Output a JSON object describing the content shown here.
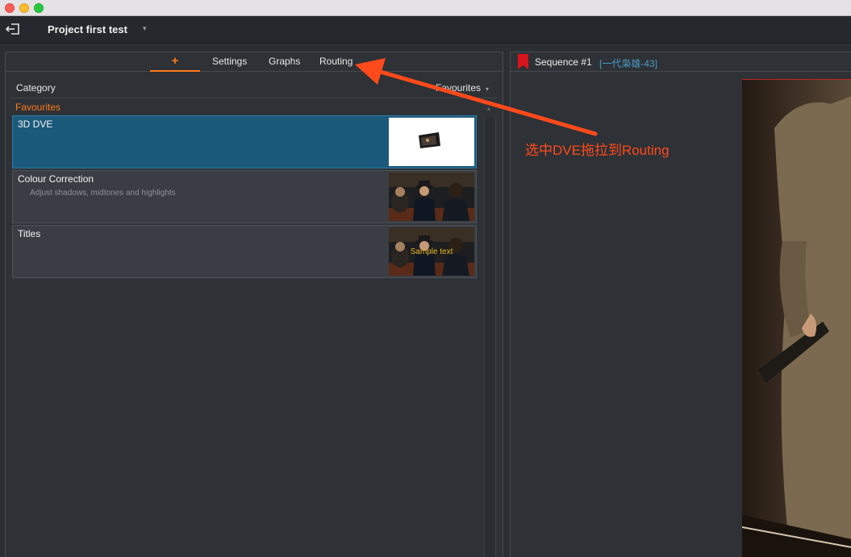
{
  "window": {
    "title": ""
  },
  "toolbar": {
    "project_title": "Project first test",
    "project_caret": "▾"
  },
  "left_panel": {
    "tabs": [
      {
        "label": "+",
        "active": true
      },
      {
        "label": "Settings",
        "active": false
      },
      {
        "label": "Graphs",
        "active": false
      },
      {
        "label": "Routing",
        "active": false
      }
    ],
    "category_label": "Category",
    "category_selected": "Favourites",
    "category_caret": "▾",
    "section_header": "Favourites",
    "items": [
      {
        "title": "3D DVE",
        "description": "",
        "selected": true
      },
      {
        "title": "Colour Correction",
        "description": "Adjust shadows, midtones and highlights",
        "selected": false
      },
      {
        "title": "Titles",
        "description": "",
        "selected": false,
        "thumb_text": "Sample text"
      }
    ]
  },
  "right_panel": {
    "sequence_title": "Sequence #1",
    "sequence_subtitle": "[一代枭雄-43]"
  },
  "annotation": {
    "text": "选中DVE拖拉到Routing",
    "color": "#ff4a1c"
  },
  "colors": {
    "accent": "#ff7a1a",
    "selection": "#1c5a7c",
    "link": "#4a9ac4"
  }
}
